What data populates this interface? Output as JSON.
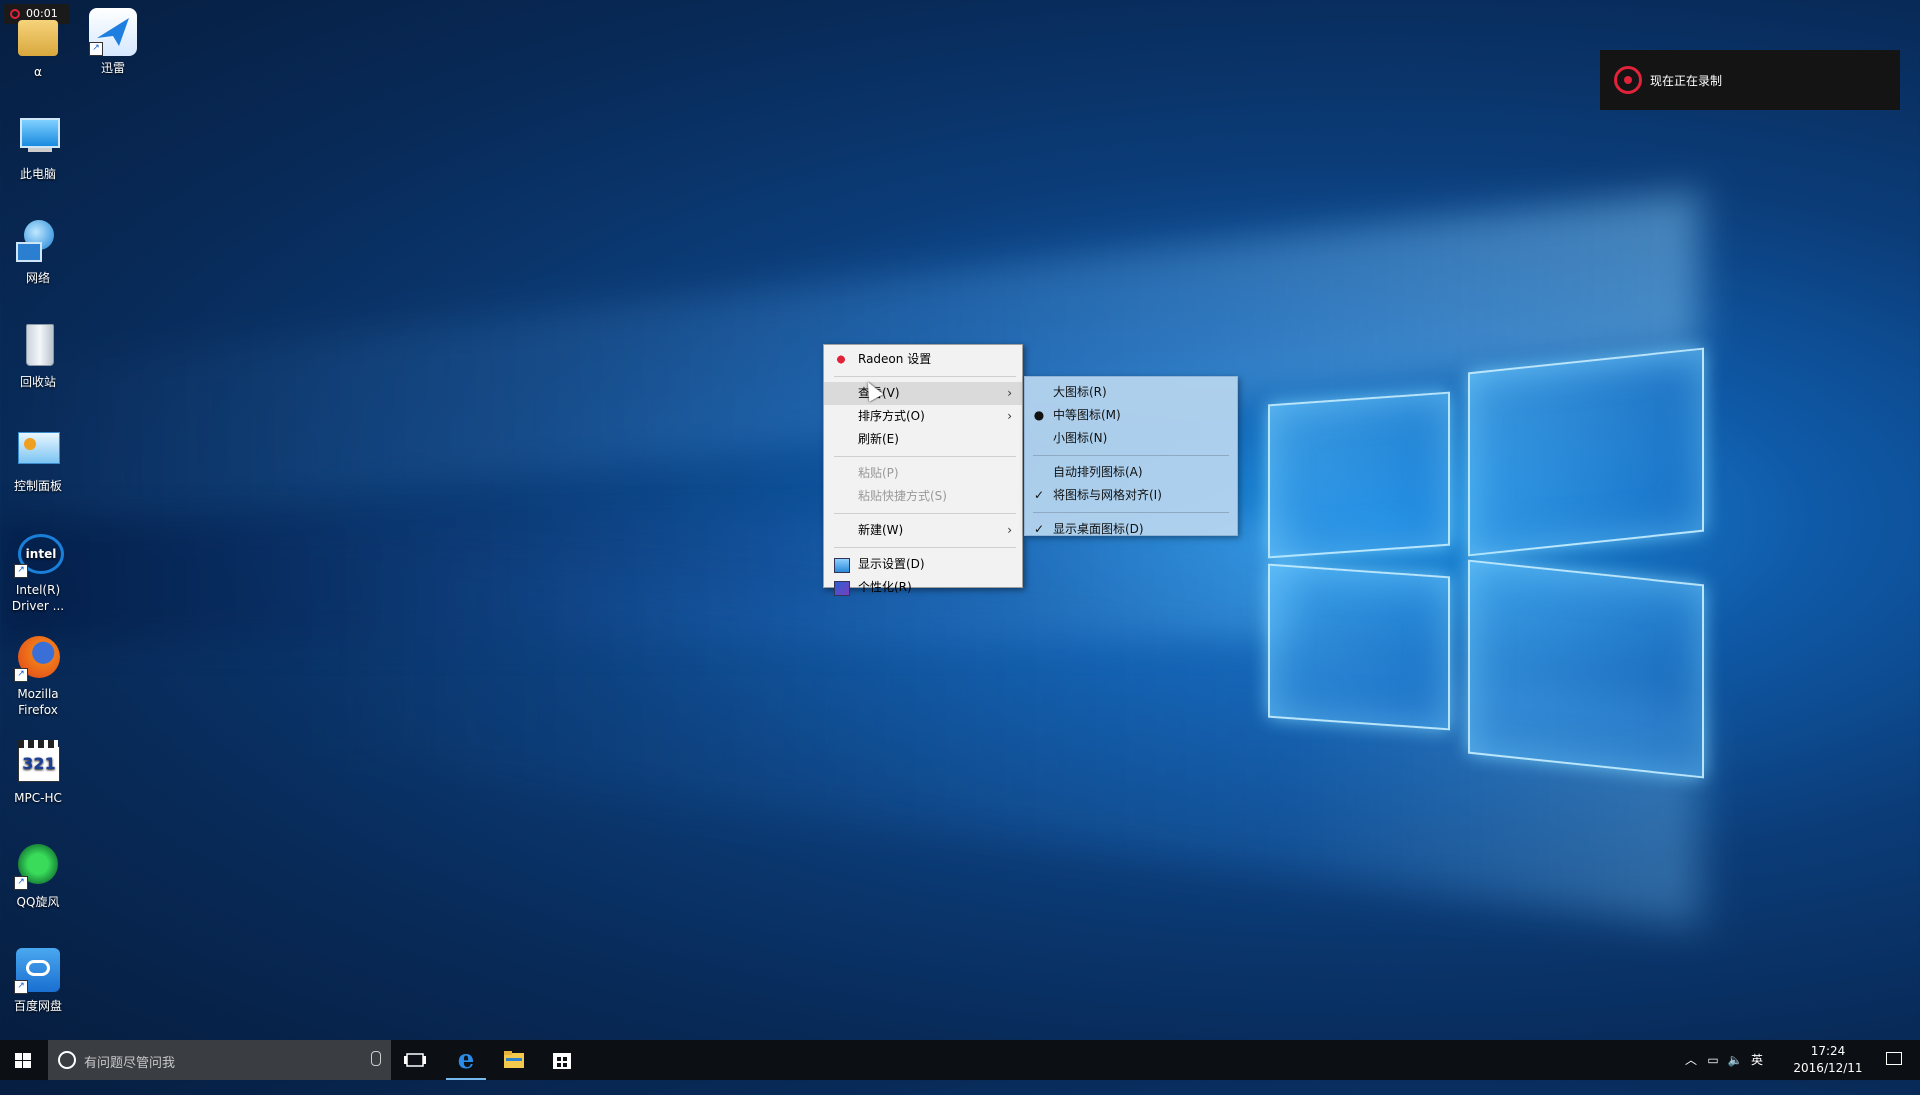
{
  "recording": {
    "timer": "00:01",
    "toast_text": "现在正在录制"
  },
  "desktop_icons": [
    {
      "label": "α",
      "icon": "user-folder-icon"
    },
    {
      "label": "迅雷",
      "icon": "xunlei-bird-icon"
    },
    {
      "label": "此电脑",
      "icon": "computer-icon"
    },
    {
      "label": "网络",
      "icon": "network-icon"
    },
    {
      "label": "回收站",
      "icon": "recycle-bin-icon"
    },
    {
      "label": "控制面板",
      "icon": "control-panel-icon"
    },
    {
      "label": "Intel(R) Driver ...",
      "icon": "intel-driver-icon"
    },
    {
      "label": "Mozilla Firefox",
      "icon": "firefox-icon"
    },
    {
      "label": "MPC-HC",
      "icon": "mpc-hc-icon"
    },
    {
      "label": "QQ旋风",
      "icon": "qq-xuanfeng-icon"
    },
    {
      "label": "百度网盘",
      "icon": "baidu-netdisk-icon"
    }
  ],
  "context_menu": {
    "radeon": "Radeon 设置",
    "view": "查看(V)",
    "sort": "排序方式(O)",
    "refresh": "刷新(E)",
    "paste": "粘贴(P)",
    "paste_shortcut": "粘贴快捷方式(S)",
    "new": "新建(W)",
    "display": "显示设置(D)",
    "personalize": "个性化(R)"
  },
  "view_submenu": {
    "large": "大图标(R)",
    "medium": "中等图标(M)",
    "small": "小图标(N)",
    "auto_arrange": "自动排列图标(A)",
    "align_grid": "将图标与网格对齐(I)",
    "show_icons": "显示桌面图标(D)",
    "selected_size": "中等图标(M)"
  },
  "taskbar": {
    "search_placeholder": "有问题尽管问我",
    "apps": [
      "task-view-icon",
      "edge-icon",
      "file-explorer-icon",
      "store-icon"
    ],
    "ime": "英",
    "time": "17:24",
    "date": "2016/12/11"
  },
  "colors": {
    "accent": "#76b9ed",
    "record_red": "#e0233a"
  }
}
